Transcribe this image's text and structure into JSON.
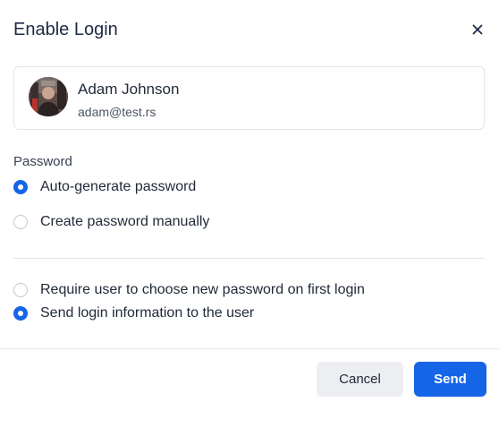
{
  "dialog": {
    "title": "Enable Login",
    "close_icon": "close-icon"
  },
  "user": {
    "name": "Adam Johnson",
    "email": "adam@test.rs"
  },
  "password_section": {
    "label": "Password",
    "options": [
      {
        "label": "Auto-generate password",
        "selected": true
      },
      {
        "label": "Create password manually",
        "selected": false
      }
    ]
  },
  "login_options": [
    {
      "label": "Require user to choose new password on first login",
      "selected": false
    },
    {
      "label": "Send login information to the user",
      "selected": true
    }
  ],
  "footer": {
    "cancel_label": "Cancel",
    "send_label": "Send"
  },
  "colors": {
    "accent": "#1565e6",
    "cancel_bg": "#eceef1",
    "border": "#e3e6ea"
  }
}
